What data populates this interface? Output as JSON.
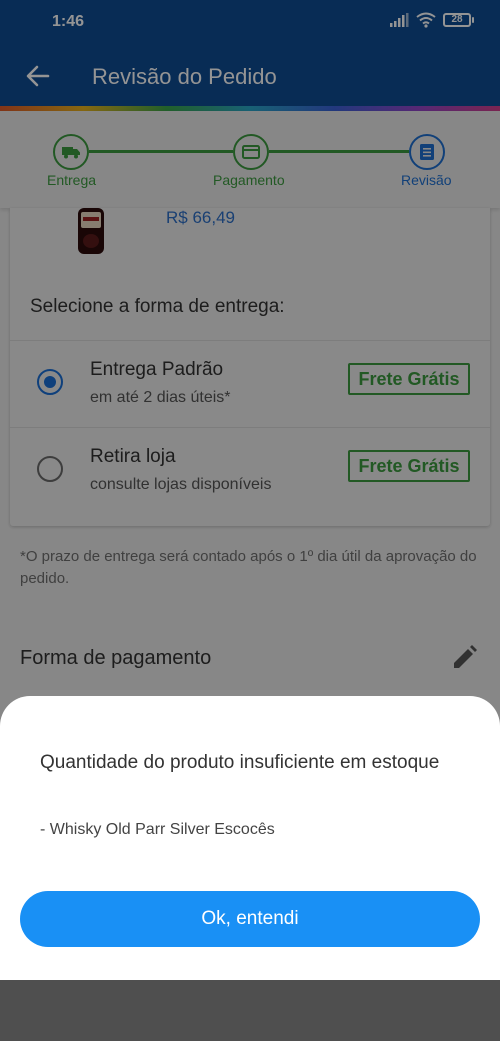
{
  "status_bar": {
    "time": "1:46",
    "battery": "28"
  },
  "app_bar": {
    "title": "Revisão do Pedido"
  },
  "stepper": {
    "steps": [
      {
        "label": "Entrega"
      },
      {
        "label": "Pagamento"
      },
      {
        "label": "Revisão"
      }
    ]
  },
  "product": {
    "price": "R$ 66,49"
  },
  "delivery": {
    "section_title": "Selecione a forma de entrega:",
    "options": [
      {
        "title": "Entrega Padrão",
        "subtitle": "em até 2 dias úteis*",
        "badge": "Frete Grátis",
        "selected": true
      },
      {
        "title": "Retira loja",
        "subtitle": "consulte lojas disponíveis",
        "badge": "Frete Grátis",
        "selected": false
      }
    ],
    "note": "*O prazo de entrega será contado após o 1º dia útil da aprovação do pedido."
  },
  "payment": {
    "title": "Forma de pagamento"
  },
  "modal": {
    "title": "Quantidade do produto insuficiente em estoque",
    "item": "- Whisky Old Parr Silver Escocês",
    "button_label": "Ok, entendi"
  },
  "colors": {
    "primary": "#0e4c93",
    "step_done": "#3c9a3f",
    "step_active": "#1e6fd0",
    "button": "#1990f5"
  },
  "icons": [
    "signal-icon",
    "wifi-icon",
    "battery-icon",
    "back-arrow-icon",
    "truck-icon",
    "card-icon",
    "review-icon",
    "bottle-image",
    "pencil-icon"
  ]
}
